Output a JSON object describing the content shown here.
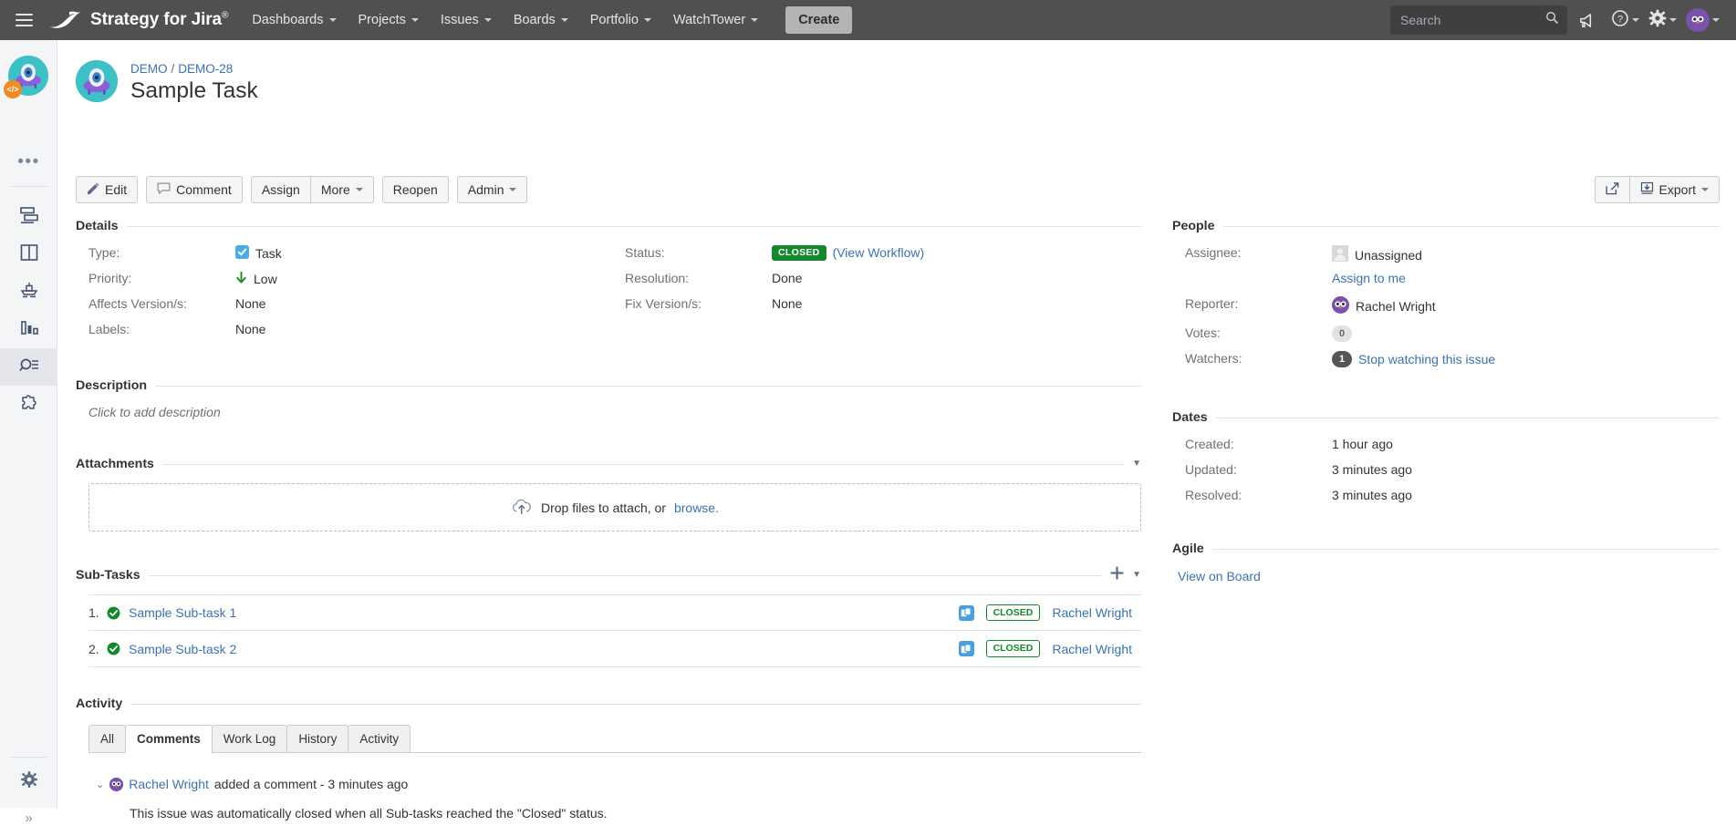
{
  "topnav": {
    "brand": "Strategy for Jira",
    "brand_sup": "®",
    "items": [
      {
        "label": "Dashboards",
        "icon": "chevron-down-icon"
      },
      {
        "label": "Projects",
        "icon": "chevron-down-icon"
      },
      {
        "label": "Issues",
        "icon": "chevron-down-icon"
      },
      {
        "label": "Boards",
        "icon": "chevron-down-icon"
      },
      {
        "label": "Portfolio",
        "icon": "chevron-down-icon"
      },
      {
        "label": "WatchTower",
        "icon": "chevron-down-icon"
      }
    ],
    "create_label": "Create",
    "search_placeholder": "Search",
    "search_value": "",
    "icons": [
      "menu-icon",
      "search-icon",
      "megaphone-icon",
      "help-icon",
      "settings-gear-icon",
      "user-avatar-icon"
    ],
    "bg_color": "#505050"
  },
  "sidebar": {
    "project_avatar_name": "project-avatar",
    "more_label": "•••",
    "items": [
      {
        "name": "backlog-icon"
      },
      {
        "name": "board-icon"
      },
      {
        "name": "releases-icon"
      },
      {
        "name": "reports-icon"
      },
      {
        "name": "issues-icon",
        "active": true
      },
      {
        "name": "add-ons-icon"
      }
    ],
    "bottom": [
      {
        "name": "project-settings-gear-icon"
      },
      {
        "name": "expand-sidebar-icon",
        "label": "»"
      }
    ]
  },
  "issue": {
    "breadcrumb": {
      "project": "DEMO",
      "separator": "/",
      "key": "DEMO-28"
    },
    "title": "Sample Task"
  },
  "toolbar": {
    "edit_label": "Edit",
    "comment_label": "Comment",
    "assign_label": "Assign",
    "more_label": "More",
    "reopen_label": "Reopen",
    "admin_label": "Admin",
    "share_label": "",
    "export_label": "Export"
  },
  "details": {
    "heading": "Details",
    "left": [
      {
        "label": "Type:",
        "value": "Task",
        "icon": "task-type-icon"
      },
      {
        "label": "Priority:",
        "value": "Low",
        "icon": "priority-low-icon"
      },
      {
        "label": "Affects Version/s:",
        "value": "None"
      },
      {
        "label": "Labels:",
        "value": "None"
      }
    ],
    "right": [
      {
        "label": "Status:",
        "value": "CLOSED",
        "link": "(View Workflow)",
        "badge": true
      },
      {
        "label": "Resolution:",
        "value": "Done"
      },
      {
        "label": "Fix Version/s:",
        "value": "None"
      }
    ]
  },
  "description": {
    "heading": "Description",
    "placeholder": "Click to add description"
  },
  "attachments": {
    "heading": "Attachments",
    "drop_text": "Drop files to attach, or",
    "browse_label": "browse.",
    "icon": "cloud-upload-icon"
  },
  "subtasks": {
    "heading": "Sub-Tasks",
    "add_icon": "plus-icon",
    "collapse_icon": "chevron-down-icon",
    "rows": [
      {
        "num": "1.",
        "name": "Sample Sub-task 1",
        "status": "CLOSED",
        "assignee": "Rachel Wright"
      },
      {
        "num": "2.",
        "name": "Sample Sub-task 2",
        "status": "CLOSED",
        "assignee": "Rachel Wright"
      }
    ]
  },
  "activity": {
    "heading": "Activity",
    "tabs": [
      {
        "label": "All",
        "active": false
      },
      {
        "label": "Comments",
        "active": true
      },
      {
        "label": "Work Log",
        "active": false
      },
      {
        "label": "History",
        "active": false
      },
      {
        "label": "Activity",
        "active": false
      }
    ],
    "comment": {
      "author": "Rachel Wright",
      "meta": "added a comment - 3 minutes ago",
      "body": "This issue was automatically closed when all Sub-tasks reached the \"Closed\" status."
    }
  },
  "people": {
    "heading": "People",
    "assignee_label": "Assignee:",
    "assignee_value": "Unassigned",
    "assign_to_me": "Assign to me",
    "reporter_label": "Reporter:",
    "reporter_value": "Rachel Wright",
    "votes_label": "Votes:",
    "votes_value": "0",
    "watchers_label": "Watchers:",
    "watchers_value": "1",
    "watchers_link": "Stop watching this issue"
  },
  "dates": {
    "heading": "Dates",
    "rows": [
      {
        "label": "Created:",
        "value": "1 hour ago"
      },
      {
        "label": "Updated:",
        "value": "3 minutes ago"
      },
      {
        "label": "Resolved:",
        "value": "3 minutes ago"
      }
    ]
  },
  "agile": {
    "heading": "Agile",
    "link": "View on Board"
  },
  "colors": {
    "status_closed": "#14892c",
    "link": "#3b73af",
    "nav_bg": "#505050",
    "accent_teal": "#3ec1c6",
    "accent_purple": "#7b52ab"
  }
}
